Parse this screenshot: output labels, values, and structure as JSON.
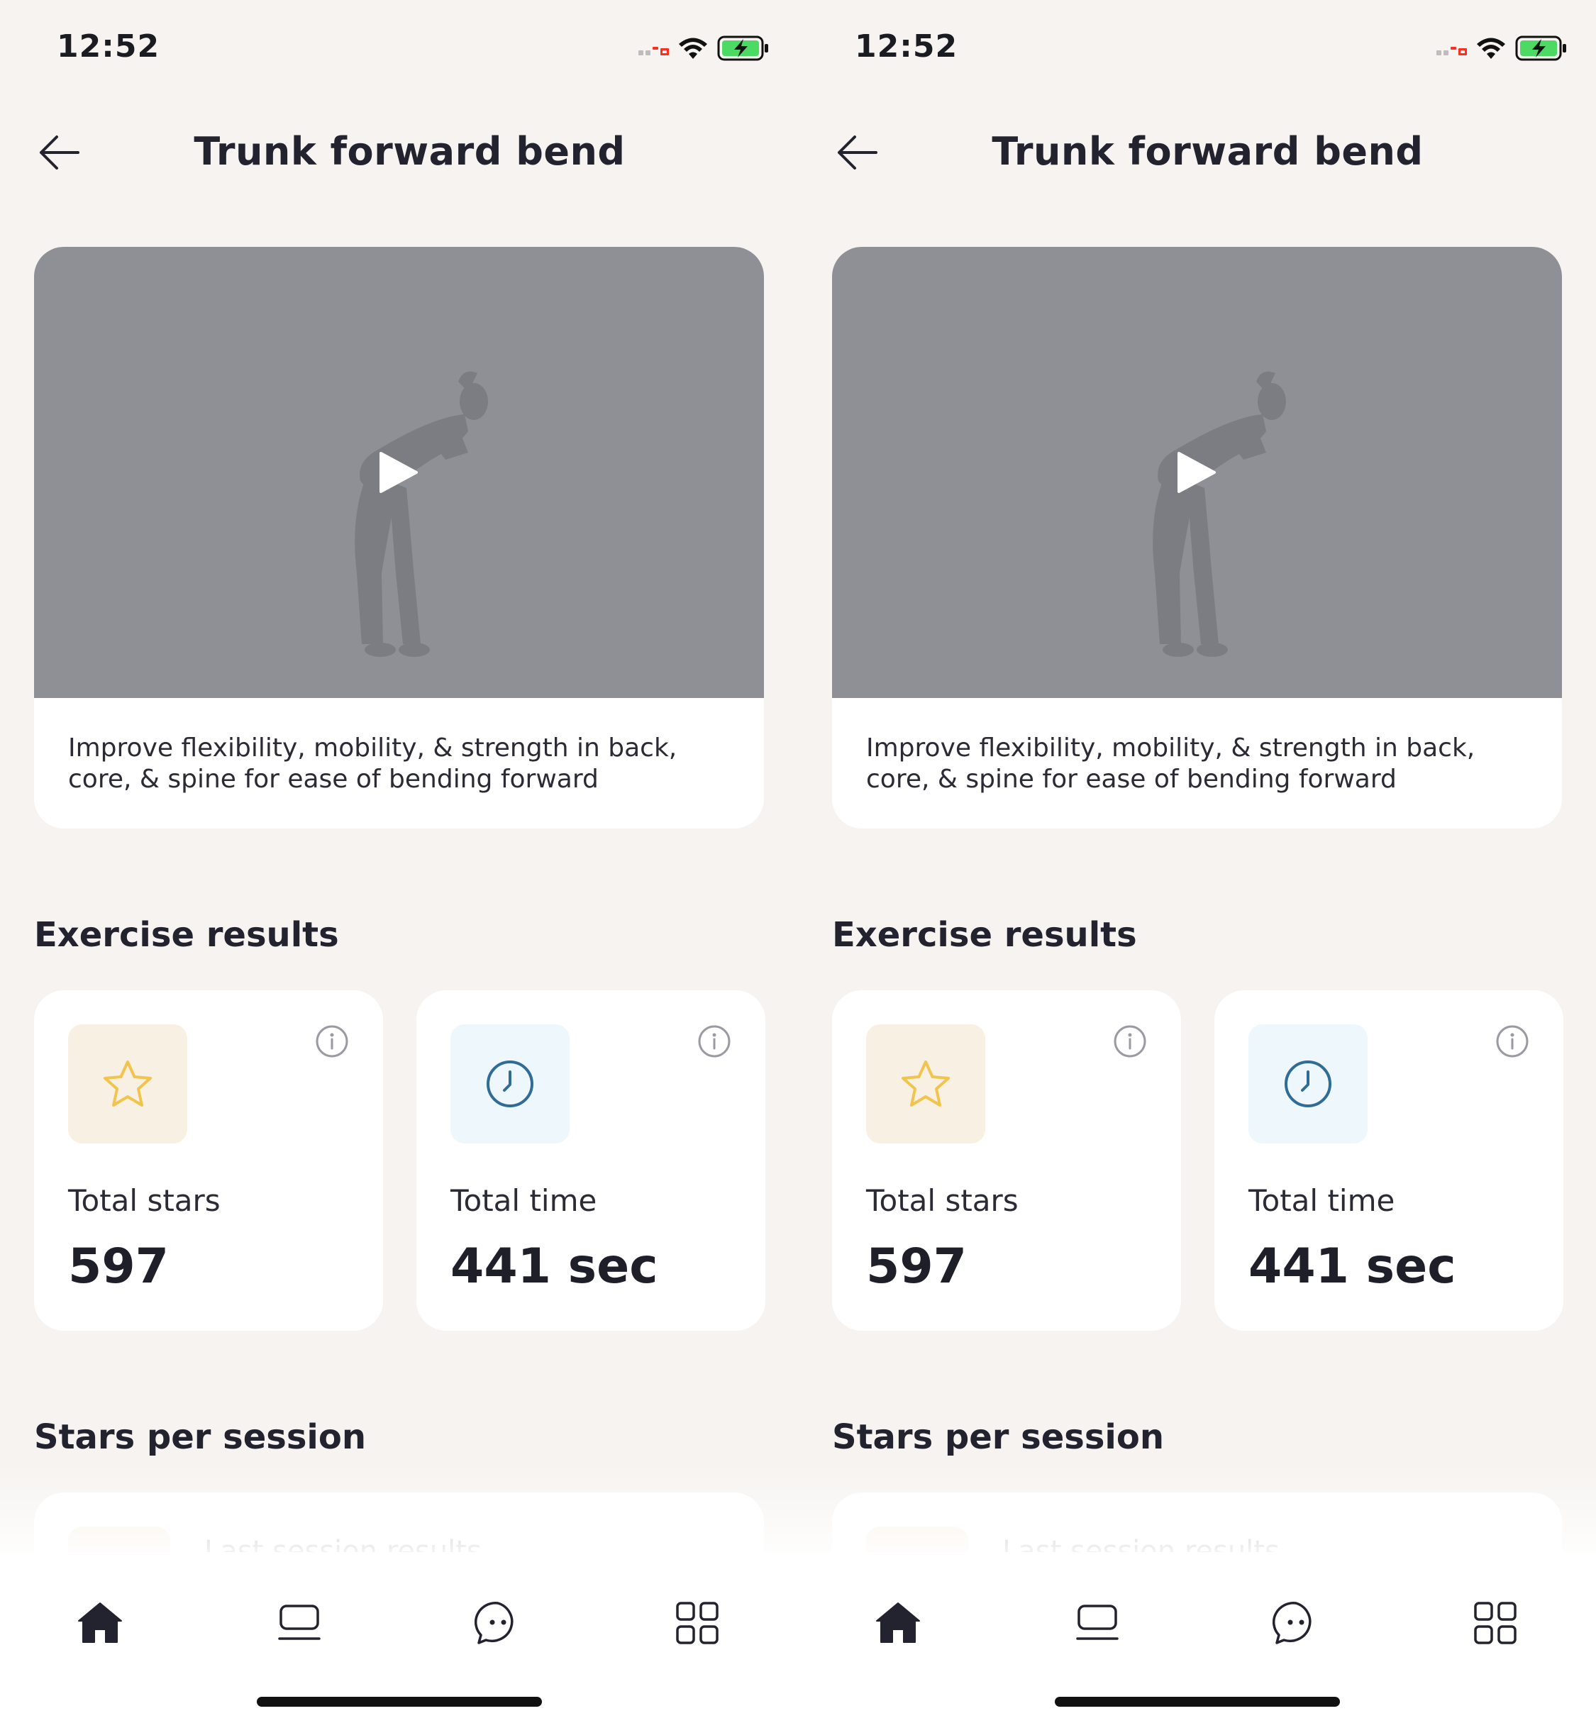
{
  "screens": [
    {
      "status_bar": {
        "time": "12:52"
      },
      "header": {
        "title": "Trunk forward bend"
      },
      "video": {
        "description": "Improve flexibility, mobility, & strength in back, core, & spine for ease of bending forward"
      },
      "exercise_results": {
        "title": "Exercise results",
        "total_stars": {
          "label": "Total stars",
          "value": "597"
        },
        "total_time": {
          "label": "Total time",
          "value": "441 sec"
        }
      },
      "stars_per_session": {
        "title": "Stars per session",
        "card_label": "Last session results"
      }
    },
    {
      "status_bar": {
        "time": "12:52"
      },
      "header": {
        "title": "Trunk forward bend"
      },
      "video": {
        "description": "Improve flexibility, mobility, & strength in back, core, & spine for ease of bending forward"
      },
      "exercise_results": {
        "title": "Exercise results",
        "total_stars": {
          "label": "Total stars",
          "value": "597"
        },
        "total_time": {
          "label": "Total time",
          "value": "441 sec"
        }
      },
      "stars_per_session": {
        "title": "Stars per session",
        "card_label": "Last session results"
      }
    }
  ],
  "icons": {
    "back": "arrow-left-icon",
    "play": "play-icon",
    "star": "star-icon",
    "clock": "clock-icon",
    "info": "info-icon",
    "tabs": [
      "home-icon",
      "laptop-icon",
      "chat-icon",
      "grid-icon"
    ]
  },
  "colors": {
    "background": "#f6f3f0",
    "card": "#ffffff",
    "video_bg": "#8f9095",
    "star_accent": "#f1c44e",
    "star_box": "#f8f0e2",
    "clock_accent": "#2f6c96",
    "clock_box": "#eef7fb",
    "battery_green": "#4cd964",
    "text_primary": "#23232f"
  }
}
